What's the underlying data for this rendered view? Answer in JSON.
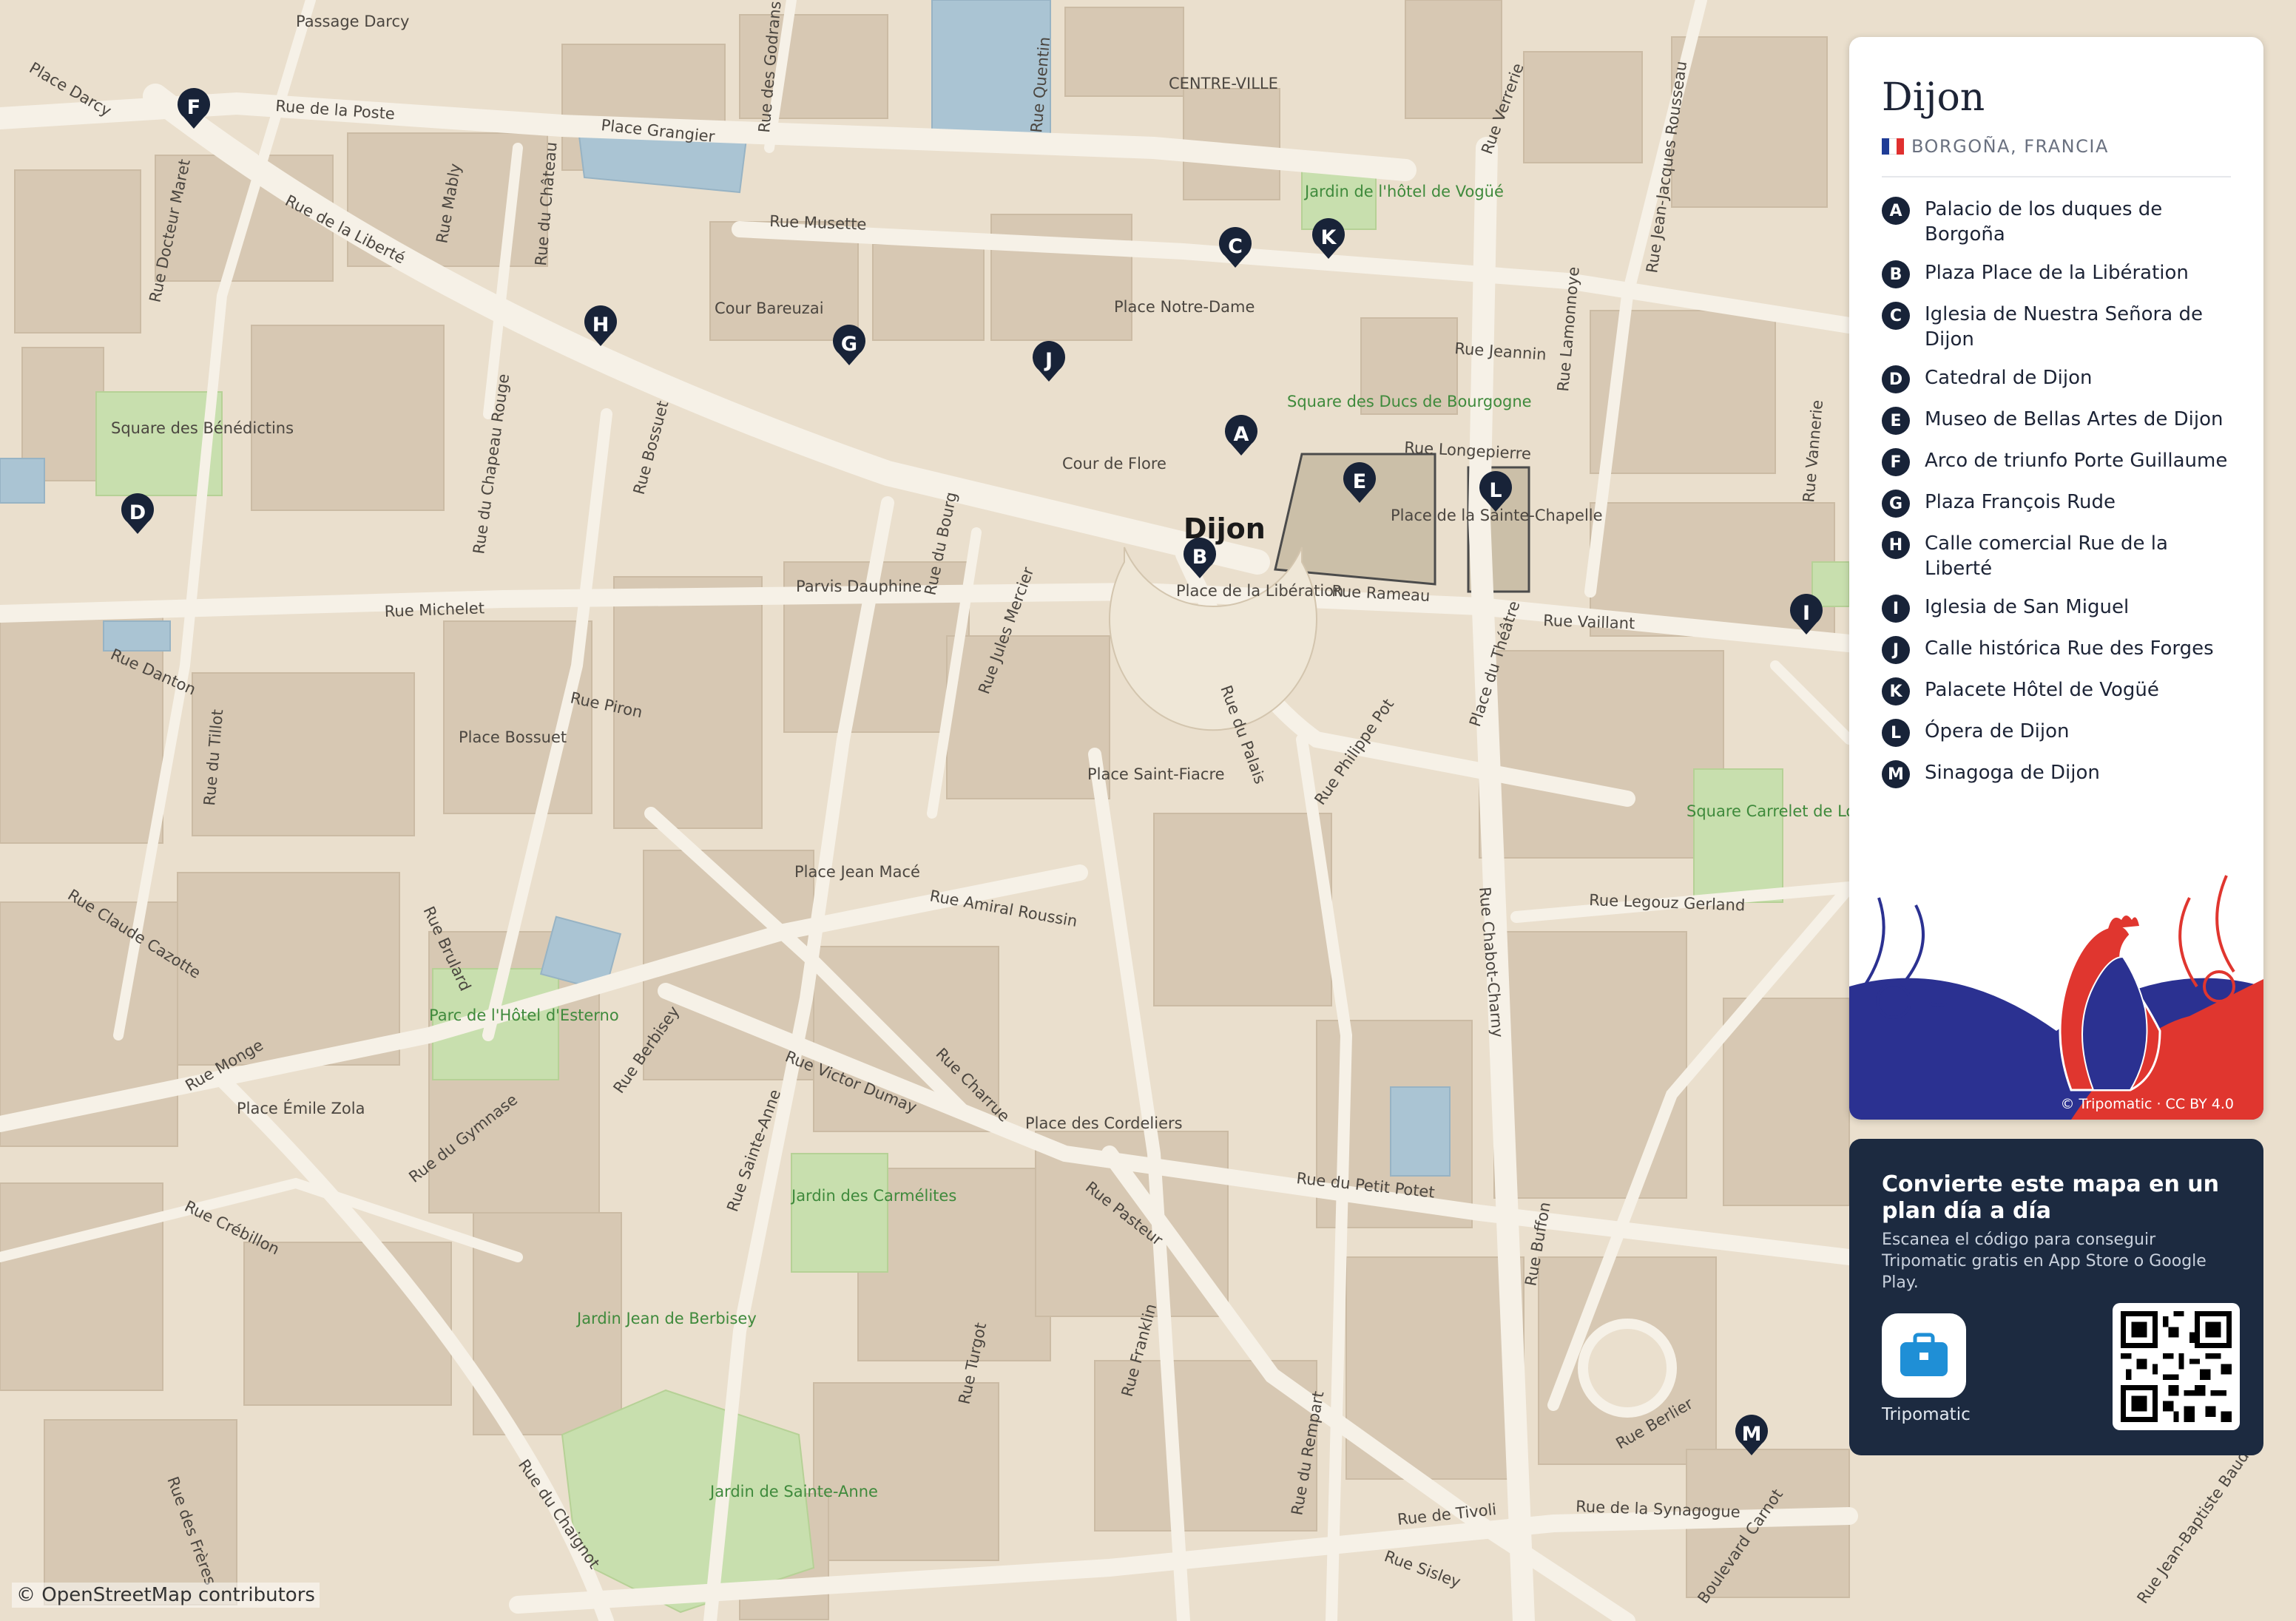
{
  "map": {
    "city_label": "Dijon",
    "attribution": "© OpenStreetMap contributors",
    "street_labels": [
      "Passage Darcy",
      "Place Darcy",
      "Rue de la Poste",
      "Place Grangier",
      "Rue des Godrans",
      "Rue Quentin",
      "CENTRE-VILLE",
      "Rue Verrerie",
      "Rue Jean-Jacques Rousseau",
      "Rue Docteur Maret",
      "Rue de la Liberté",
      "Rue Mably",
      "Rue du Château",
      "Rue Musette",
      "Jardin de l'hôtel de Vogüé",
      "Rue Lamonnoye",
      "Cour Bareuzai",
      "Place Notre-Dame",
      "Rue Jeannin",
      "Square des Bénédictins",
      "Rue du Chapeau Rouge",
      "Rue Bossuet",
      "Square des Ducs de Bourgogne",
      "Rue Longepierre",
      "Cour de Flore",
      "Place de la Sainte-Chapelle",
      "Place de la Libération",
      "Rue Rameau",
      "Parvis Dauphine",
      "Rue du Bourg",
      "Rue Jules Mercier",
      "Rue Michelet",
      "Rue Vaillant",
      "Rue Danton",
      "Rue du Tillot",
      "Rue Piron",
      "Place Bossuet",
      "Rue du Palais",
      "Rue Philippe Pot",
      "Place du Théâtre",
      "Place Saint-Fiacre",
      "Rue Claude Cazotte",
      "Rue Brulard",
      "Place Jean Macé",
      "Rue Amiral Roussin",
      "Square Carrelet de Loisy",
      "Rue Legouz Gerland",
      "Rue Chabot-Charny",
      "Parc de l'Hôtel d'Esterno",
      "Rue Monge",
      "Rue Berbisey",
      "Rue Victor Dumay",
      "Rue Charrue",
      "Place Émile Zola",
      "Rue du Gymnase",
      "Place des Cordeliers",
      "Rue Buffon",
      "Rue Crébillon",
      "Rue Sainte-Anne",
      "Jardin des Carmélites",
      "Rue du Petit Potet",
      "Rue Pasteur",
      "Jardin Jean de Berbisey",
      "Rue Turgot",
      "Rue Franklin",
      "Rue du Rempart",
      "Rue Berlier",
      "Jardin de Sainte-Anne",
      "Rue du Chaignot",
      "Rue des Frères",
      "Rue de Tivoli",
      "Rue de la Synagogue",
      "Rue Sisley",
      "Boulevard Carnot",
      "Rue Jean-Baptiste Baudin",
      "Rue Vannerie"
    ],
    "pins": [
      "A",
      "B",
      "C",
      "D",
      "E",
      "F",
      "G",
      "H",
      "I",
      "J",
      "K",
      "L",
      "M"
    ]
  },
  "panel": {
    "title": "Dijon",
    "region": "BORGOÑA, FRANCIA",
    "flag_colors": [
      "#1f3c96",
      "#ffffff",
      "#e0302f"
    ],
    "pois": [
      {
        "letter": "A",
        "name": "Palacio de los duques de Borgoña"
      },
      {
        "letter": "B",
        "name": "Plaza Place de la Libération"
      },
      {
        "letter": "C",
        "name": "Iglesia de Nuestra Señora de Dijon"
      },
      {
        "letter": "D",
        "name": "Catedral de Dijon"
      },
      {
        "letter": "E",
        "name": "Museo de Bellas Artes de Dijon"
      },
      {
        "letter": "F",
        "name": "Arco de triunfo Porte Guillaume"
      },
      {
        "letter": "G",
        "name": "Plaza François Rude"
      },
      {
        "letter": "H",
        "name": "Calle comercial Rue de la Liberté"
      },
      {
        "letter": "I",
        "name": "Iglesia de San Miguel"
      },
      {
        "letter": "J",
        "name": "Calle histórica Rue des Forges"
      },
      {
        "letter": "K",
        "name": "Palacete Hôtel de Vogüé"
      },
      {
        "letter": "L",
        "name": "Ópera de Dijon"
      },
      {
        "letter": "M",
        "name": "Sinagoga de Dijon"
      }
    ],
    "art_credit": "© Tripomatic · CC BY 4.0"
  },
  "promo": {
    "title": "Convierte este mapa en un plan día a día",
    "description": "Escanea el código para conseguir Tripomatic gratis en App Store o Google Play.",
    "app_name": "Tripomatic"
  },
  "colors": {
    "pin": "#182338",
    "promo_bg": "#1c2a40",
    "park": "#c8dfae",
    "building": "#d6c7b2",
    "street": "#f6f1e7"
  }
}
